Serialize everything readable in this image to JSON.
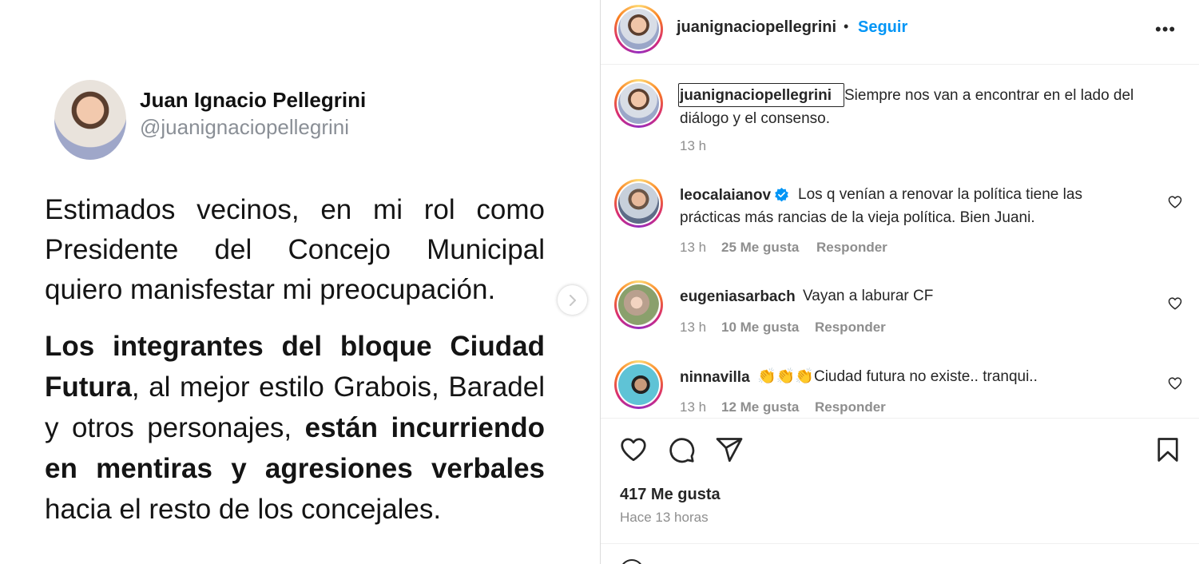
{
  "post": {
    "author_name": "Juan Ignacio Pellegrini",
    "author_handle": "@juanignaciopellegrini",
    "paragraph1": "Estimados vecinos, en mi rol como Presidente del Concejo Municipal quiero manisfestar mi preocupación.",
    "paragraph2": {
      "bold1": "Los integrantes del bloque Ciudad Futura",
      "normal1": ", al mejor estilo Grabois, Baradel y otros personajes, ",
      "bold2": "están incurriendo en mentiras y agresiones verbales",
      "normal2": " hacia el resto de los concejales."
    },
    "next_icon": "chevron-right-icon"
  },
  "header": {
    "username": "juanignaciopellegrini",
    "separator": "•",
    "follow_label": "Seguir",
    "more_label": "•••"
  },
  "caption": {
    "username": "juanignaciopellegrini",
    "text": "Siempre nos van a encontrar en el lado del",
    "text_line2": "diálogo y el consenso.",
    "time": "13 h"
  },
  "comments": [
    {
      "username": "leocalaianov",
      "verified": true,
      "text": "Los q venían a renovar la política tiene las",
      "text_line2": "prácticas más rancias de la vieja política. Bien Juani.",
      "time": "13 h",
      "likes": "25 Me gusta",
      "reply": "Responder"
    },
    {
      "username": "eugeniasarbach",
      "verified": false,
      "text": "Vayan a laburar CF",
      "time": "13 h",
      "likes": "10 Me gusta",
      "reply": "Responder"
    },
    {
      "username": "ninnavilla",
      "verified": false,
      "text": "👏👏👏Ciudad futura no existe.. tranqui..",
      "time": "13 h",
      "likes": "12 Me gusta",
      "reply": "Responder"
    }
  ],
  "actions": {
    "icons": [
      "heart-icon",
      "comment-icon",
      "share-icon",
      "bookmark-icon"
    ]
  },
  "stats": {
    "likes": "417 Me gusta",
    "time_ago": "Hace 13 horas"
  },
  "colors": {
    "accent": "#0095f6",
    "text": "#262626",
    "muted": "#8e8e8e"
  }
}
